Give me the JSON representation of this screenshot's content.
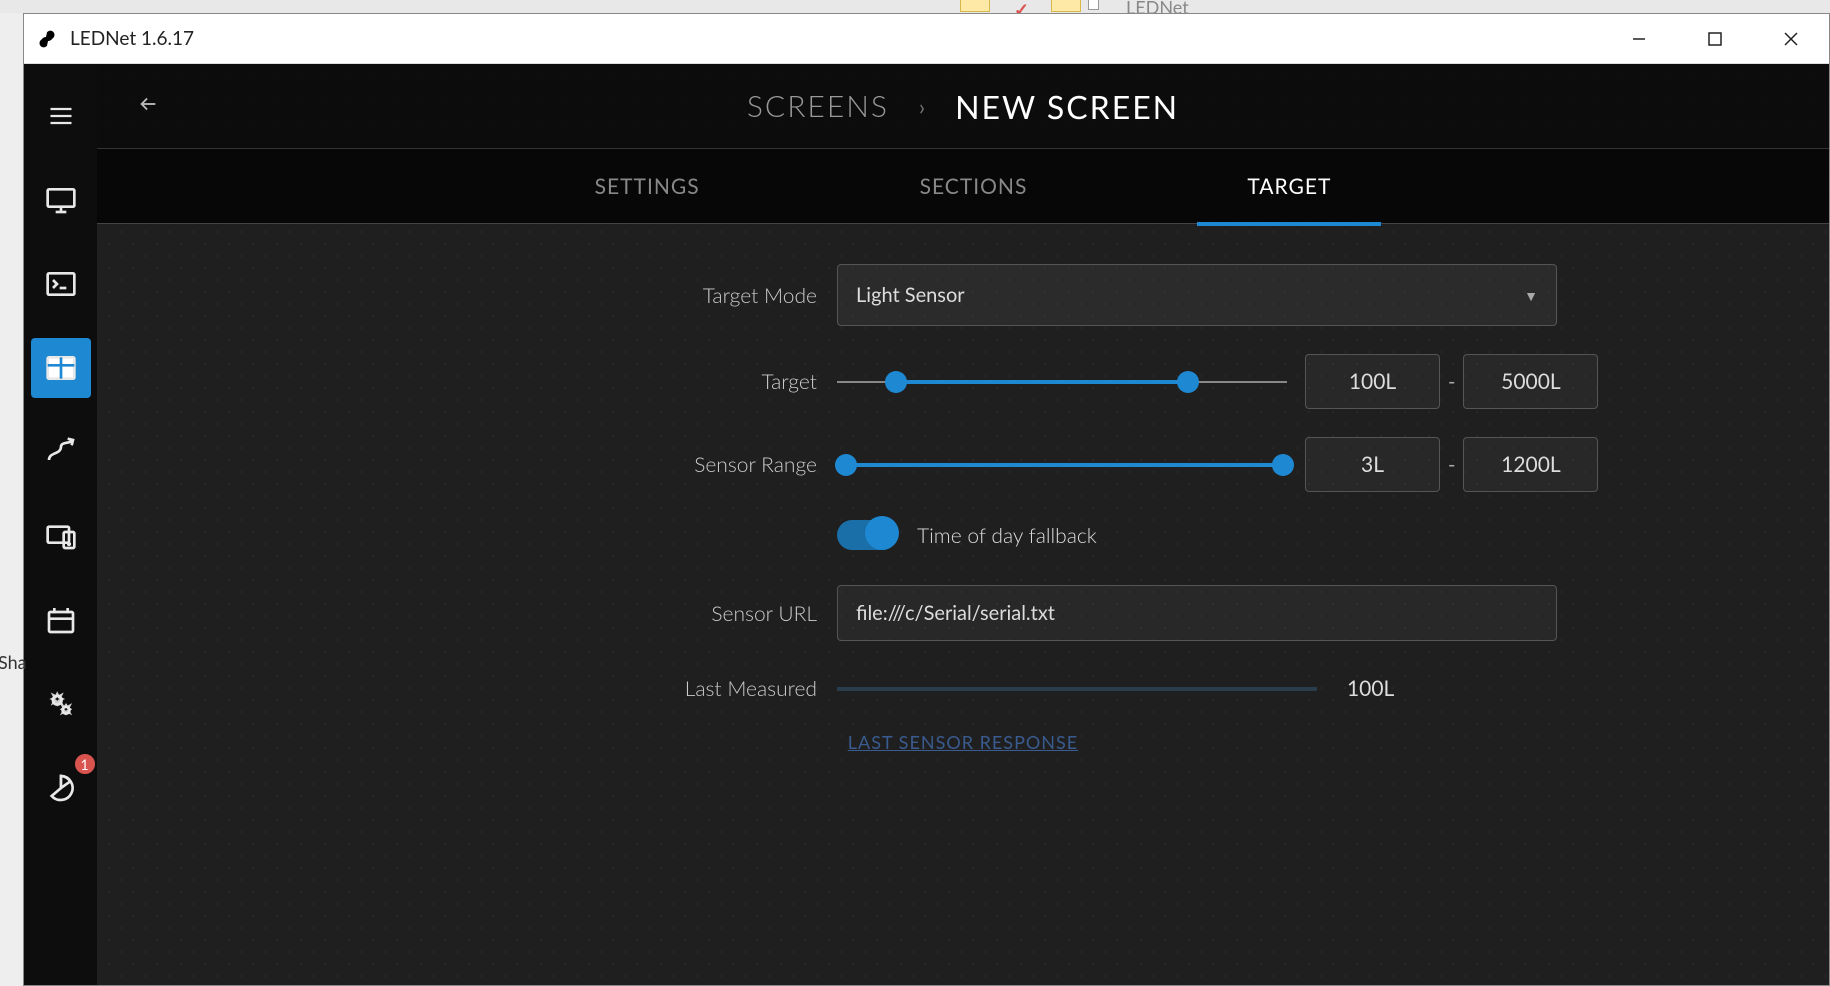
{
  "taskbar": {
    "app_name": "LEDNet"
  },
  "window": {
    "title": "LEDNet 1.6.17"
  },
  "sidebar": {
    "badge_count": "1"
  },
  "behind_fragment": "Sha",
  "breadcrumb": {
    "parent": "SCREENS",
    "separator": "›",
    "current": "NEW SCREEN"
  },
  "tabs": {
    "settings": "SETTINGS",
    "sections": "SECTIONS",
    "target": "TARGET"
  },
  "form": {
    "target_mode_label": "Target Mode",
    "target_mode_value": "Light Sensor",
    "target_label": "Target",
    "target_min": "100L",
    "target_max": "5000L",
    "sensor_range_label": "Sensor Range",
    "sensor_range_min": "3L",
    "sensor_range_max": "1200L",
    "dash": "-",
    "fallback_label": "Time of day fallback",
    "sensor_url_label": "Sensor URL",
    "sensor_url_value": "file:///c/Serial/serial.txt",
    "last_measured_label": "Last Measured",
    "last_measured_value": "100L",
    "last_sensor_link": "LAST SENSOR RESPONSE"
  }
}
